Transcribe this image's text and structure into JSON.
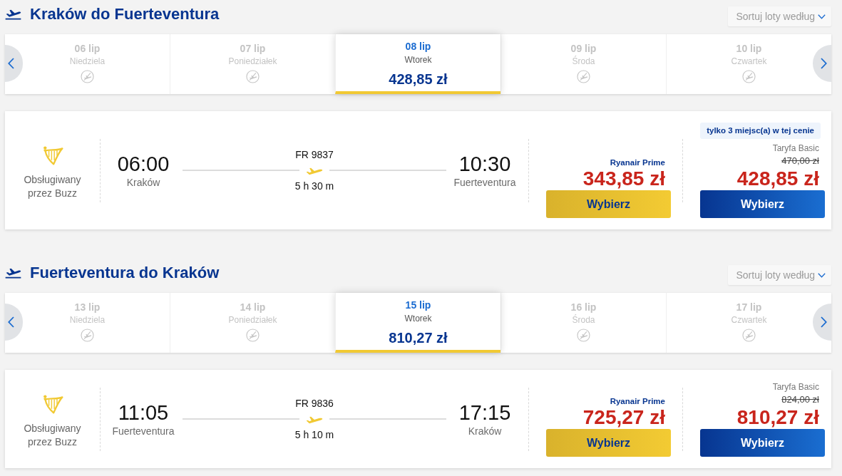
{
  "sections": [
    {
      "title": "Kraków do Fuerteventura",
      "sort_label": "Sortuj loty według",
      "dates": [
        {
          "date": "06 lip",
          "day": "Niedziela",
          "kind": "no_flights",
          "selected": false
        },
        {
          "date": "07 lip",
          "day": "Poniedziałek",
          "kind": "no_flights",
          "selected": false
        },
        {
          "date": "08 lip",
          "day": "Wtorek",
          "kind": "fare",
          "price": "428,85 zł",
          "selected": true
        },
        {
          "date": "09 lip",
          "day": "Środa",
          "kind": "no_flights",
          "selected": false
        },
        {
          "date": "10 lip",
          "day": "Czwartek",
          "kind": "no_flights",
          "selected": false
        }
      ],
      "flight": {
        "operator": "Obsługiwany przez Buzz",
        "departure": {
          "time": "06:00",
          "airport": "Kraków"
        },
        "flight_number": "FR 9837",
        "duration": "5 h 30 m",
        "arrival": {
          "time": "10:30",
          "airport": "Fuerteventura"
        },
        "fares": [
          {
            "kind": "prime",
            "name": "Ryanair Prime",
            "price": "343,85 zł",
            "button": "Wybierz"
          },
          {
            "kind": "basic",
            "badge": "tylko 3 miejsc(a) w tej cenie",
            "name": "Taryfa Basic",
            "old_price": "470,00 zł",
            "price": "428,85 zł",
            "button": "Wybierz"
          }
        ]
      }
    },
    {
      "title": "Fuerteventura do Kraków",
      "sort_label": "Sortuj loty według",
      "dates": [
        {
          "date": "13 lip",
          "day": "Niedziela",
          "kind": "no_flights",
          "selected": false
        },
        {
          "date": "14 lip",
          "day": "Poniedziałek",
          "kind": "no_flights",
          "selected": false
        },
        {
          "date": "15 lip",
          "day": "Wtorek",
          "kind": "fare",
          "price": "810,27 zł",
          "selected": true
        },
        {
          "date": "16 lip",
          "day": "Środa",
          "kind": "no_flights",
          "selected": false
        },
        {
          "date": "17 lip",
          "day": "Czwartek",
          "kind": "no_flights",
          "selected": false
        }
      ],
      "flight": {
        "operator": "Obsługiwany przez Buzz",
        "departure": {
          "time": "11:05",
          "airport": "Fuerteventura"
        },
        "flight_number": "FR 9836",
        "duration": "5 h 10 m",
        "arrival": {
          "time": "17:15",
          "airport": "Kraków"
        },
        "fares": [
          {
            "kind": "prime",
            "name": "Ryanair Prime",
            "price": "725,27 zł",
            "button": "Wybierz"
          },
          {
            "kind": "basic",
            "name": "Taryfa Basic",
            "old_price": "824,00 zł",
            "price": "810,27 zł",
            "button": "Wybierz"
          }
        ]
      }
    }
  ]
}
